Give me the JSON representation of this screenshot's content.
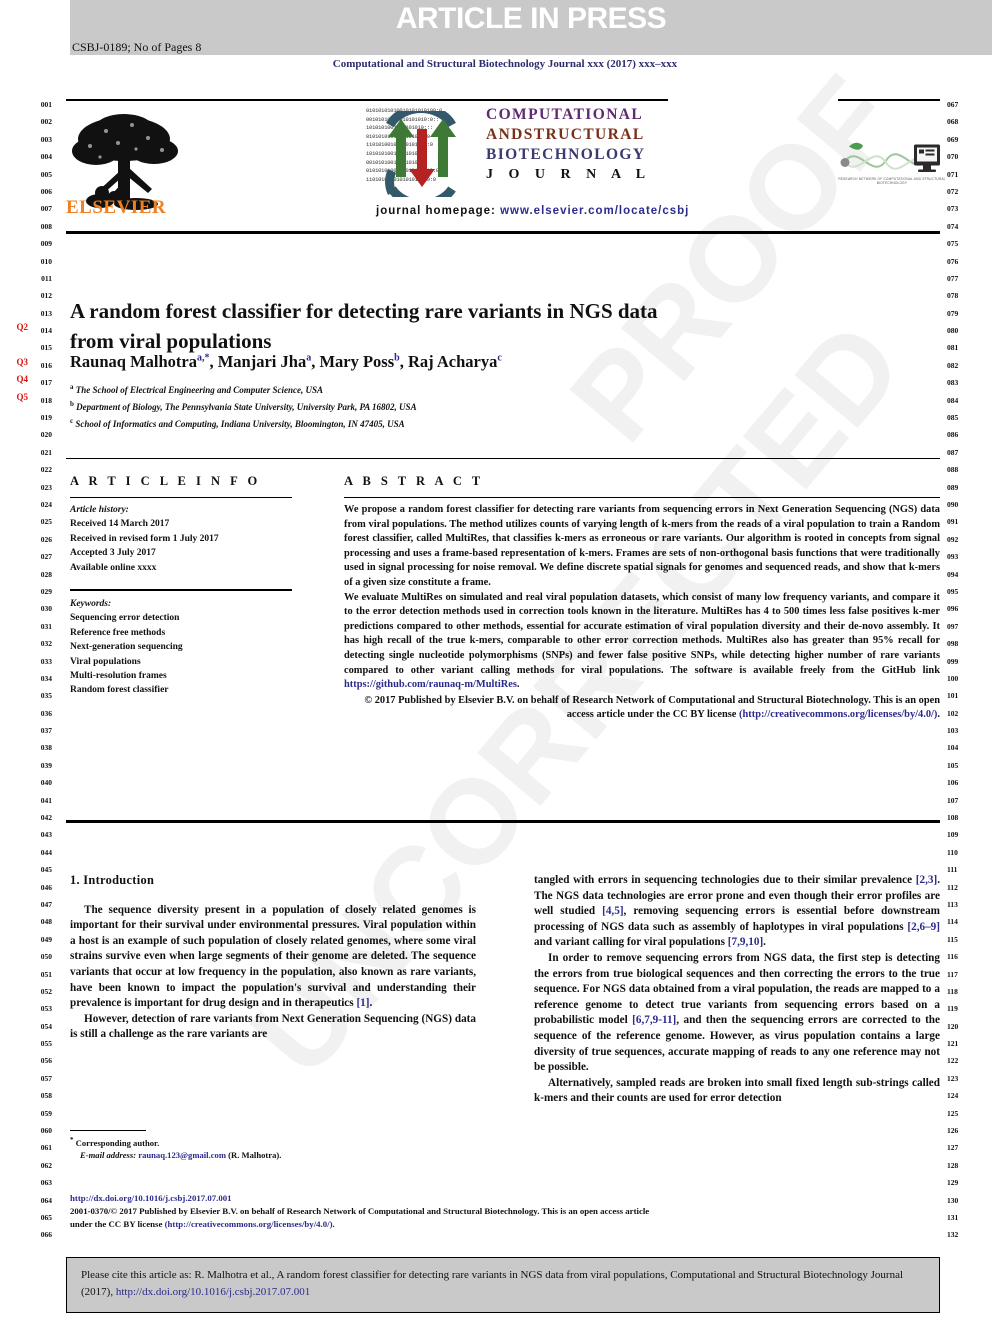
{
  "banner": {
    "title": "ARTICLE IN PRESS",
    "code": "CSBJ-0189; No of Pages 8"
  },
  "running_head": "Computational and Structural Biotechnology Journal xxx (2017) xxx–xxx",
  "masthead": {
    "publisher": "ELSEVIER",
    "journal_lines": [
      "COMPUTATIONAL",
      "ANDSTRUCTURAL",
      "BIOTECHNOLOGY",
      "J O U R N A L"
    ],
    "homepage_label": "journal homepage:",
    "homepage_url": "www.elsevier.com/locate/csbj",
    "logo_bits": "01010101010010101010100:0\n00101010010010101010:0::\n1010101001010101010:::\n01010101010101010:::0\n11010100101010101010:0\n10101010010101010:::\n00101010010101010:::\n0101010100101010101010:0\n110101010010101010010:0",
    "right_logo_caption": "RESEARCH NETWORK OF COMPUTATIONAL AND STRUCTURAL BIOTECHNOLOGY"
  },
  "article": {
    "title": "A random forest classifier for detecting rare variants in NGS data from viral populations",
    "authors": [
      {
        "name": "Raunaq  Malhotra",
        "marks": "a,*"
      },
      {
        "name": "Manjari Jha",
        "marks": "a"
      },
      {
        "name": "Mary Poss",
        "marks": "b"
      },
      {
        "name": "Raj Acharya",
        "marks": "c"
      }
    ],
    "affiliations": [
      {
        "mark": "a",
        "text": "The School of Electrical Engineering and Computer Science, USA"
      },
      {
        "mark": "b",
        "text": "Department of Biology, The Pennsylvania State University, University Park, PA 16802, USA"
      },
      {
        "mark": "c",
        "text": "School of Informatics and Computing, Indiana University, Bloomington, IN 47405, USA"
      }
    ]
  },
  "article_info": {
    "heading": "A R T I C L E    I N F O",
    "history_label": "Article history:",
    "history": [
      "Received 14 March 2017",
      "Received in revised form 1 July 2017",
      "Accepted 3 July 2017",
      "Available online xxxx"
    ],
    "keywords_label": "Keywords:",
    "keywords": [
      "Sequencing error detection",
      "Reference free methods",
      "Next-generation sequencing",
      "Viral populations",
      "Multi-resolution frames",
      "Random forest classifier"
    ]
  },
  "abstract": {
    "heading": "A B S T R A C T",
    "p1": "We propose a random forest classifier for detecting rare variants from sequencing errors in Next Generation Sequencing (NGS) data from viral populations. The method utilizes counts of varying length of k-mers from the reads of a viral population to train a Random forest classifier, called MultiRes, that classifies k-mers as erroneous or rare variants. Our algorithm is rooted in concepts from signal processing and uses a frame-based representation of k-mers. Frames are sets of non-orthogonal basis functions that were traditionally used in signal processing for noise removal. We define discrete spatial signals for genomes and sequenced reads, and show that k-mers of a given size constitute a frame.",
    "p2_pre": "We evaluate MultiRes on simulated and real viral population datasets, which consist of many low frequency variants, and compare it to the error detection methods used in correction tools known in the literature. MultiRes has 4 to 500 times less false positives k-mer predictions compared to other methods, essential for accurate estimation of viral population diversity and their de-novo assembly. It has high recall of the true k-mers, comparable to other error correction methods. MultiRes also has greater than 95% recall for detecting single nucleotide polymorphisms (SNPs) and fewer false positive SNPs, while detecting higher number of rare variants compared to other variant calling methods for viral populations. The software is available freely from the GitHub link ",
    "github_link": "https://github.com/raunaq-m/MultiRes",
    "p2_post": ".",
    "copyright": "© 2017 Published by Elsevier B.V. on behalf of Research Network of Computational and Structural Biotechnology. This is an open access article under the CC BY license",
    "license_link": "(http://creativecommons.org/licenses/by/4.0/)",
    "license_tail": "."
  },
  "body": {
    "section_title": "1. Introduction",
    "left_p1_a": "The sequence diversity present in a population of closely related genomes is important for their survival under environmental pressures. Viral population within a host is an example of such population of closely related genomes, where some viral strains survive even when large segments of their genome are deleted. The sequence variants that occur at low frequency in the population, also known as rare variants, have been known to impact the population's survival and understanding their prevalence is important for drug design and in therapeutics ",
    "left_p1_ref": "[1]",
    "left_p1_b": ".",
    "left_p2": "However, detection of rare variants from Next Generation Sequencing (NGS) data is still a challenge as the rare variants are",
    "right_p1_a": "tangled with errors in sequencing technologies due to their similar prevalence ",
    "right_p1_r1": "[2,3]",
    "right_p1_b": ". The NGS data technologies are error prone and even though their error profiles are well studied ",
    "right_p1_r2": "[4,5]",
    "right_p1_c": ", removing sequencing errors is essential before downstream processing of NGS data such as assembly of haplotypes in viral populations ",
    "right_p1_r3": "[2,6–9]",
    "right_p1_d": " and variant calling for viral populations ",
    "right_p1_r4": "[7,9,10]",
    "right_p1_e": ".",
    "right_p2_a": "In order to remove sequencing errors from NGS data, the first step is detecting the errors from true biological sequences and then correcting the errors to the true sequence. For NGS data obtained from a viral population, the reads are mapped to a reference genome to detect true variants from sequencing errors based on a probabilistic model ",
    "right_p2_r1": "[6,7,9-11]",
    "right_p2_b": ", and then the sequencing errors are corrected to the sequence of the reference genome. However, as virus population contains a large diversity of true sequences, accurate mapping of reads to any one reference may not be possible.",
    "right_p3": "Alternatively, sampled reads are broken into small fixed length sub-strings called k-mers and their counts are used for error detection"
  },
  "footnote": {
    "star": "*",
    "corresponding": "Corresponding author.",
    "email_label": "E-mail address:",
    "email": "raunaq.123@gmail.com",
    "email_owner": "(R. Malhotra)."
  },
  "pubinfo": {
    "doi": "http://dx.doi.org/10.1016/j.csbj.2017.07.001",
    "issn_line_a": "2001-0370/© 2017 Published by Elsevier B.V. on behalf of Research Network of Computational and Structural Biotechnology. This is an open access article under the CC BY license ",
    "license_link": "(http://creativecommons.org/licenses/by/4.0/)",
    "issn_line_b": "."
  },
  "cite_box": {
    "text": "Please cite this article as: R. Malhotra et al., A random forest classifier for detecting rare variants in NGS data from viral populations, Computational and Structural Biotechnology Journal (2017), ",
    "link": "http://dx.doi.org/10.1016/j.csbj.2017.07.001"
  },
  "line_numbers": {
    "left_start": 1,
    "left_end": 66,
    "right_start": 67,
    "right_end": 132,
    "queries": [
      {
        "id": "Q2",
        "line": 14
      },
      {
        "id": "Q3",
        "line": 16
      },
      {
        "id": "Q4",
        "line": 17
      },
      {
        "id": "Q5",
        "line": 18
      }
    ]
  },
  "colors": {
    "link": "#2b2b8c",
    "query_marker": "#e01010",
    "banner_bg": "#c9c9c9",
    "elsevier_orange": "#f08020"
  },
  "watermark": "UNCORRECTED PROOF"
}
